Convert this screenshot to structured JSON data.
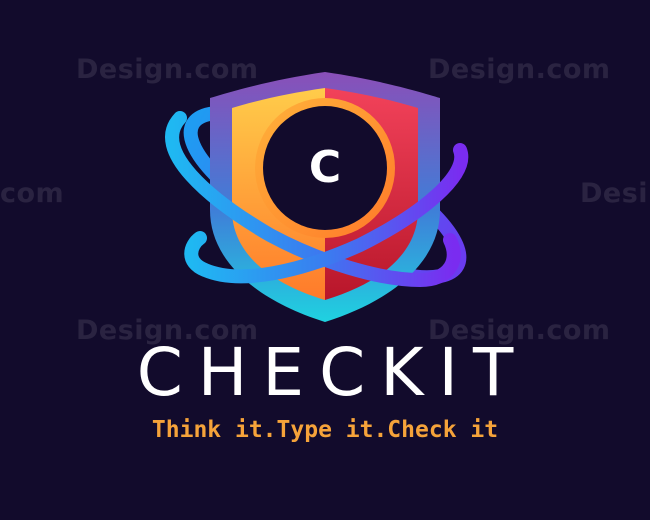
{
  "brand": {
    "name": "CHECKIT",
    "tagline": "Think it.Type it.Check it",
    "emblem_letter": "C"
  },
  "watermark": {
    "text_full": "Design.com",
    "text_left_fragment": "com",
    "text_right_fragment": "Desi"
  },
  "colors": {
    "background": "#120b2c",
    "shield_left": "#ffb23a",
    "shield_right": "#e0313f",
    "shield_frame_top": "#8a4fb8",
    "shield_frame_bottom": "#1fd2e0",
    "ring_blue": "#1fb8f2",
    "ring_purple": "#7a2cf0",
    "tagline": "#f5a33a",
    "title": "#ffffff"
  },
  "icons": {
    "logo": "shield-orbit-logo-icon"
  }
}
